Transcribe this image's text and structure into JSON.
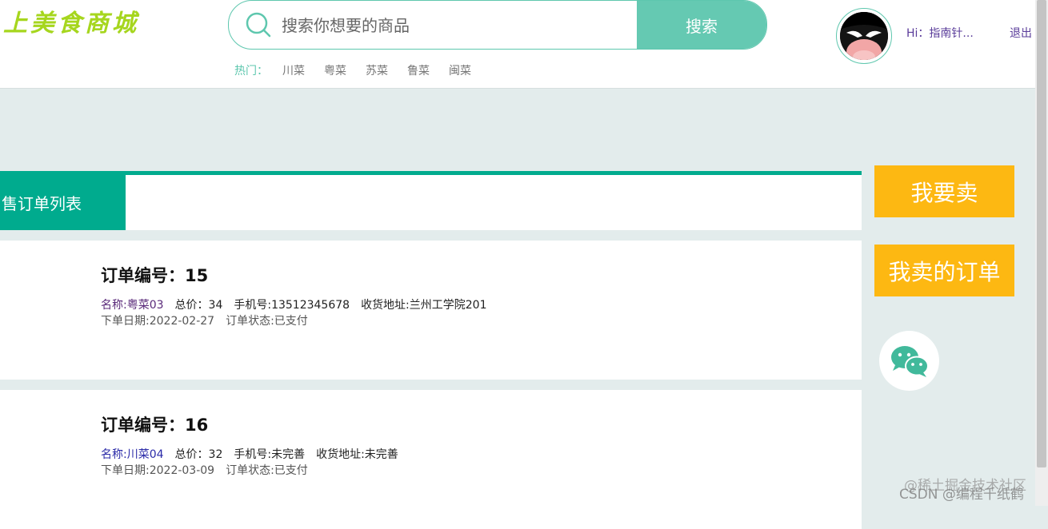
{
  "header": {
    "logo_text": "上美食商城",
    "search": {
      "placeholder": "搜索你想要的商品",
      "button_label": "搜索"
    },
    "hot": {
      "label": "热门：",
      "items": [
        "川菜",
        "粤菜",
        "苏菜",
        "鲁菜",
        "闽菜"
      ]
    },
    "user": {
      "greeting": "Hi：指南针...",
      "logout_label": "退出"
    }
  },
  "panel": {
    "tab_label": "售订单列表"
  },
  "orders": [
    {
      "title": "订单编号：15",
      "name": "名称:粤菜03",
      "total": "总价：34",
      "phone": "手机号:13512345678",
      "address": "收货地址:兰州工学院201",
      "date": "下单日期:2022-02-27",
      "status": "订单状态:已支付"
    },
    {
      "title": "订单编号：16",
      "name": "名称:川菜04",
      "total": "总价：32",
      "phone": "手机号:未完善",
      "address": "收货地址:未完善",
      "date": "下单日期:2022-03-09",
      "status": "订单状态:已支付"
    }
  ],
  "sidebar": {
    "sell_label": "我要卖",
    "my_orders_label": "我卖的订单"
  },
  "watermark": {
    "line1": "@稀土掘金技术社区",
    "line2": "CSDN @编程千纸鹤"
  },
  "colors": {
    "accent": "#00ab8e",
    "search_button": "#65c9b2",
    "side_button": "#fdb812",
    "background": "#e3ecec"
  }
}
